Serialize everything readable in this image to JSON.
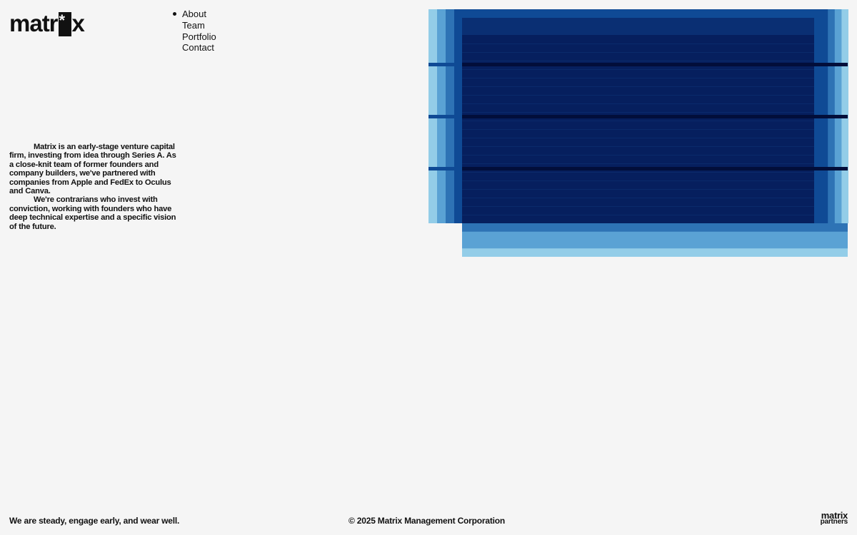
{
  "brand": {
    "logo_prefix": "matr",
    "logo_suffix": "x",
    "footer_logo_line1": "matrix",
    "footer_logo_line2": "partners"
  },
  "nav": {
    "items": [
      {
        "label": "About",
        "active": true
      },
      {
        "label": "Team",
        "active": false
      },
      {
        "label": "Portfolio",
        "active": false
      },
      {
        "label": "Contact",
        "active": false
      }
    ]
  },
  "intro": {
    "paragraphs": [
      "Matrix is an early-stage venture capital firm, investing from idea through Series A. As a close-knit team of former founders and company builders, we've partnered with companies from Apple and FedEx to Oculus and Canva.",
      "We're contrarians who invest with conviction, working with founders who have deep technical expertise and a specific vision of the future."
    ]
  },
  "artwork": {
    "palette": [
      "#93cde8",
      "#5aa2d4",
      "#2e73b5",
      "#0f4a95",
      "#0a2f73",
      "#061f5e",
      "#020e3a"
    ]
  },
  "footer": {
    "tagline": "We are steady, engage early, and wear well.",
    "copyright": "© 2025 Matrix Management Corporation"
  }
}
